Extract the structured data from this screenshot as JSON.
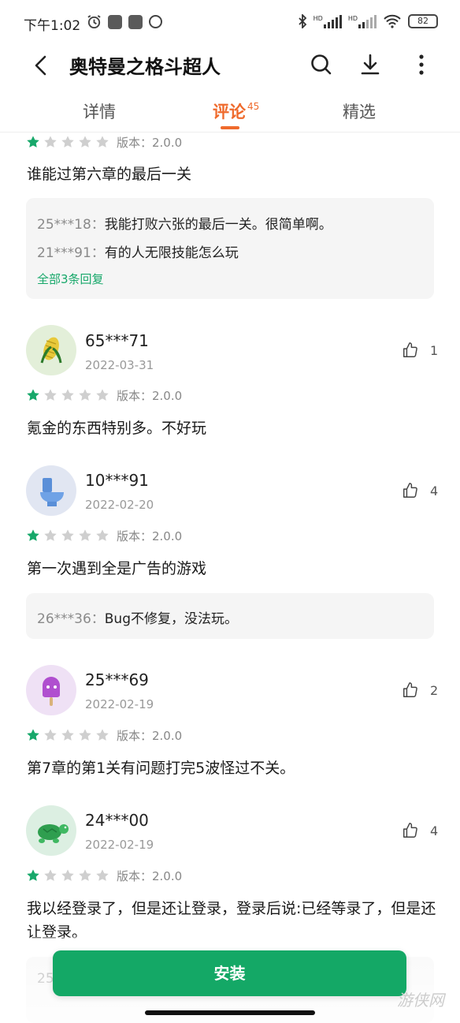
{
  "status_bar": {
    "time": "下午1:02",
    "hd1": "HD",
    "hd2": "HD",
    "battery": "82"
  },
  "header": {
    "title": "奥特曼之格斗超人"
  },
  "tabs": [
    {
      "label": "详情"
    },
    {
      "label": "评论",
      "count": "45"
    },
    {
      "label": "精选"
    }
  ],
  "colors": {
    "accent": "#ef6a2c",
    "green": "#14a866",
    "star_on": "#17a86a",
    "star_off": "#cfcfcf"
  },
  "reviews": [
    {
      "rating": 1,
      "version": "版本：2.0.0",
      "text": "谁能过第六章的最后一关",
      "replies": [
        {
          "user": "25***18：",
          "text": "我能打败六张的最后一关。很简单啊。"
        },
        {
          "user": "21***91：",
          "text": "有的人无限技能怎么玩"
        }
      ],
      "more": "全部3条回复"
    },
    {
      "avatar_icon": "corn-icon",
      "user": "65***71",
      "date": "2022-03-31",
      "likes": "1",
      "rating": 1,
      "version": "版本：2.0.0",
      "text": "氪金的东西特别多。不好玩"
    },
    {
      "avatar_icon": "toilet-icon",
      "user": "10***91",
      "date": "2022-02-20",
      "likes": "4",
      "rating": 1,
      "version": "版本：2.0.0",
      "text": "第一次遇到全是广告的游戏",
      "replies": [
        {
          "user": "26***36：",
          "text": "Bug不修复，没法玩。"
        }
      ]
    },
    {
      "avatar_icon": "popsicle-icon",
      "user": "25***69",
      "date": "2022-02-19",
      "likes": "2",
      "rating": 1,
      "version": "版本：2.0.0",
      "text": "第7章的第1关有问题打完5波怪过不关。"
    },
    {
      "avatar_icon": "turtle-icon",
      "user": "24***00",
      "date": "2022-02-19",
      "likes": "4",
      "rating": 1,
      "version": "版本：2.0.0",
      "text": "我以经登录了，但是还让登录，登录后说:已经等录了，但是还让登录。",
      "replies": [
        {
          "user": "25",
          "text": ""
        }
      ]
    }
  ],
  "install_button": "安装",
  "watermark": "游侠网"
}
